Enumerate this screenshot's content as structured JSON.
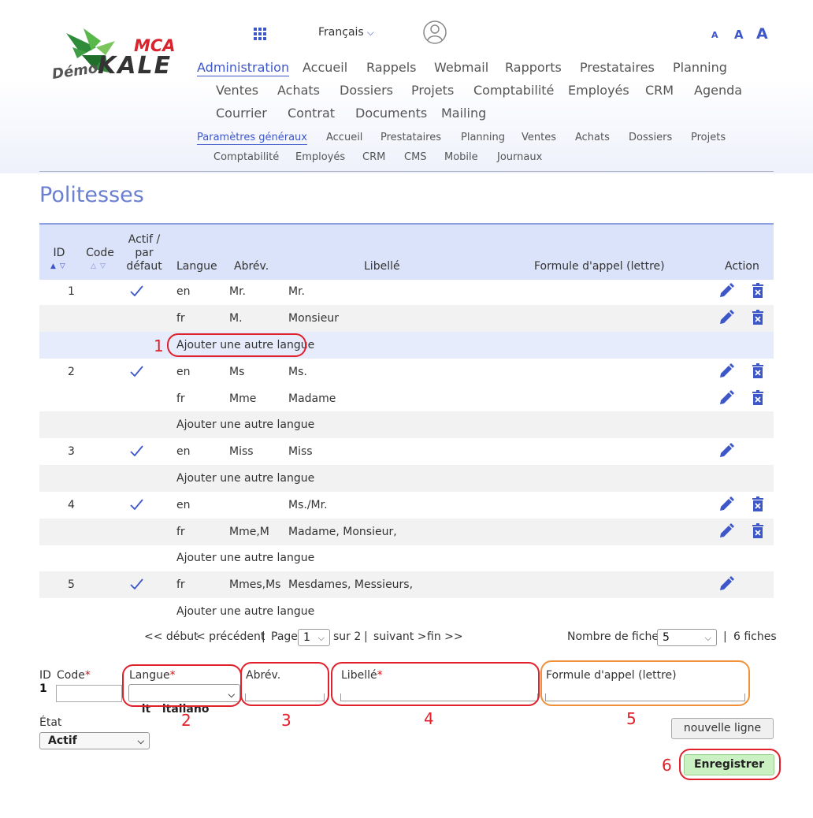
{
  "header": {
    "logo_prefix": "Démo",
    "logo_brand": "KALE",
    "logo_mca": "MCA",
    "language": "Français",
    "font_sizes": [
      "A",
      "A",
      "A"
    ]
  },
  "nav_main": [
    "Administration",
    "Accueil",
    "Rappels",
    "Webmail",
    "Rapports",
    "Prestataires",
    "Planning",
    "Ventes",
    "Achats",
    "Dossiers",
    "Projets",
    "Comptabilité",
    "Employés",
    "CRM",
    "Agenda",
    "Courrier",
    "Contrat",
    "Documents",
    "Mailing"
  ],
  "nav_sub": [
    "Paramètres généraux",
    "Accueil",
    "Prestataires",
    "Planning",
    "Ventes",
    "Achats",
    "Dossiers",
    "Projets",
    "Comptabilité",
    "Employés",
    "CRM",
    "CMS",
    "Mobile",
    "Journaux"
  ],
  "page_title": "Politesses",
  "table": {
    "headers": {
      "id": "ID",
      "code": "Code",
      "active": [
        "Actif /",
        "par",
        "défaut"
      ],
      "lang": "Langue",
      "abbr": "Abrév.",
      "label": "Libellé",
      "formula": "Formule d'appel (lettre)",
      "action": "Action"
    },
    "rows": [
      {
        "id": "1",
        "check": true,
        "lang": "en",
        "abbr": "Mr.",
        "label": "Mr.",
        "del": true
      },
      {
        "id": "",
        "check": false,
        "lang": "fr",
        "abbr": "M.",
        "label": "Monsieur",
        "del": true
      },
      {
        "add": "Ajouter une autre langue"
      },
      {
        "id": "2",
        "check": true,
        "lang": "en",
        "abbr": "Ms",
        "label": "Ms.",
        "del": true
      },
      {
        "id": "",
        "check": false,
        "lang": "fr",
        "abbr": "Mme",
        "label": "Madame",
        "del": true
      },
      {
        "add": "Ajouter une autre langue"
      },
      {
        "id": "3",
        "check": true,
        "lang": "en",
        "abbr": "Miss",
        "label": "Miss",
        "del": false
      },
      {
        "add": "Ajouter une autre langue"
      },
      {
        "id": "4",
        "check": true,
        "lang": "en",
        "abbr": "",
        "label": "Ms./Mr.",
        "del": true
      },
      {
        "id": "",
        "check": false,
        "lang": "fr",
        "abbr": "Mme,M",
        "label": "Madame, Monsieur,",
        "del": true
      },
      {
        "add": "Ajouter une autre langue"
      },
      {
        "id": "5",
        "check": true,
        "lang": "fr",
        "abbr": "Mmes,Ms",
        "label": "Mesdames, Messieurs,",
        "del": false
      },
      {
        "add": "Ajouter une autre langue"
      }
    ]
  },
  "pager": {
    "first": "<< début",
    "prev": "< précédent",
    "sep": "|",
    "page_label": "Page",
    "page_value": "1",
    "total": "sur 2",
    "next": "suivant >",
    "last": "fin >>",
    "records_label": "Nombre de fiches",
    "records_value": "5",
    "records_total": "6 fiches"
  },
  "form": {
    "id_label": "ID",
    "id_value": "1",
    "code_label": "Code",
    "lang_label": "Langue",
    "lang_value": "it   italiano",
    "abbr_label": "Abrév.",
    "label_label": "Libellé",
    "formula_label": "Formule d'appel (lettre)",
    "state_label": "État",
    "state_value": "Actif",
    "required_mark": "*",
    "new_line_button": "nouvelle ligne",
    "save_button": "Enregistrer"
  },
  "annotations": [
    "1",
    "2",
    "3",
    "4",
    "5",
    "6"
  ],
  "colors": {
    "accent": "#3d57c9",
    "annotation_red": "#e0202b",
    "annotation_orange": "#f0913a",
    "save_green": "#c9f1c2"
  }
}
